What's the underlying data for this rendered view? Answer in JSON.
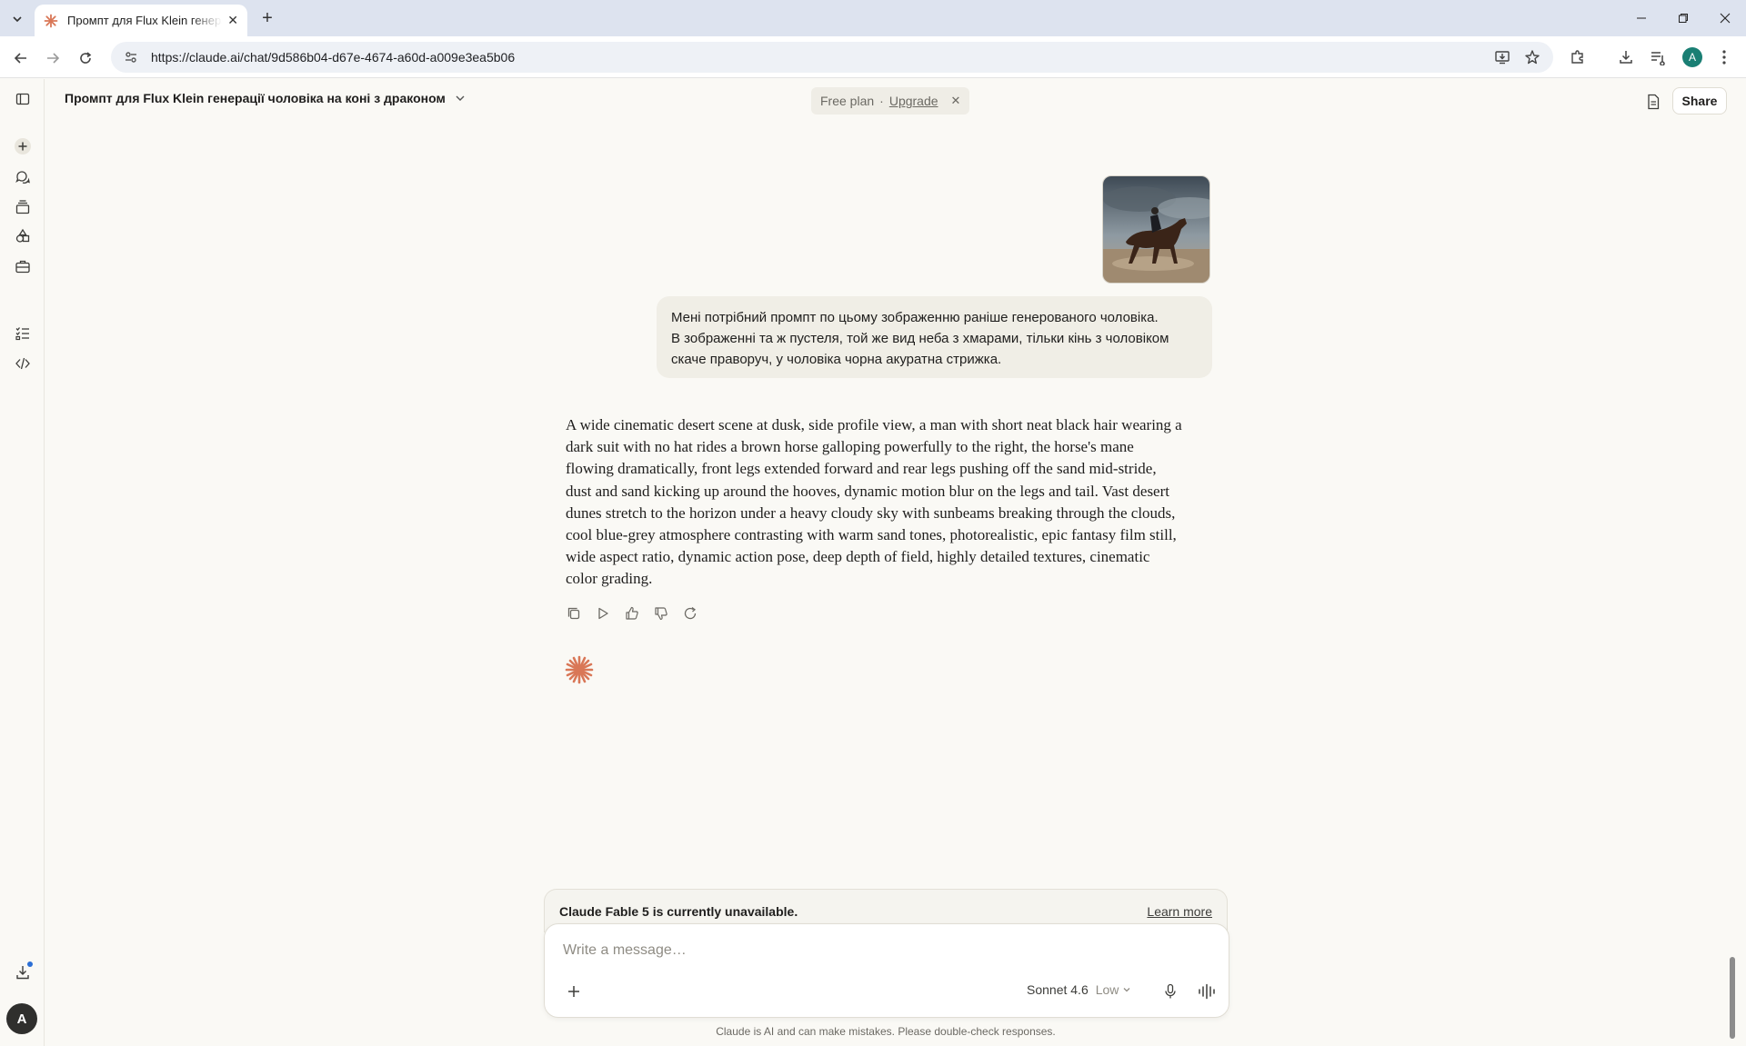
{
  "browser": {
    "tab_title": "Промпт для Flux Klein генерації чоловіка на коні з драконом",
    "url": "https://claude.ai/chat/9d586b04-d67e-4674-a60d-a009e3ea5b06",
    "profile_initial": "A"
  },
  "header": {
    "chat_title": "Промпт для Flux Klein генерації чоловіка на коні з драконом",
    "plan_label": "Free plan",
    "upgrade_label": "Upgrade",
    "share_label": "Share"
  },
  "rail": {
    "avatar_initial": "A"
  },
  "user_message": {
    "text_lines": [
      "Мені потрібний промпт по цьому зображенню раніше генерованого чоловіка.",
      "В зображенні та ж пустеля, той же вид неба з хмарами, тільки кінь з чоловіком",
      "скаче праворуч, у чоловіка чорна акуратна стрижка."
    ]
  },
  "assistant_message": {
    "text": "A wide cinematic desert scene at dusk, side profile view, a man with short neat black hair wearing a dark suit with no hat rides a brown horse galloping powerfully to the right, the horse's mane flowing dramatically, front legs extended forward and rear legs pushing off the sand mid-stride, dust and sand kicking up around the hooves, dynamic motion blur on the legs and tail. Vast desert dunes stretch to the horizon under a heavy cloudy sky with sunbeams breaking through the clouds, cool blue-grey atmosphere contrasting with warm sand tones, photorealistic, epic fantasy film still, wide aspect ratio, dynamic action pose, deep depth of field, highly detailed textures, cinematic color grading."
  },
  "composer": {
    "notice": "Claude Fable 5 is currently unavailable.",
    "learn_more": "Learn more",
    "placeholder": "Write a message…",
    "model": "Sonnet 4.6",
    "effort": "Low",
    "disclaimer": "Claude is AI and can make mistakes. Please double-check responses."
  },
  "colors": {
    "brand_orange": "#d97757",
    "page_bg": "#faf9f5",
    "bubble_bg": "#f0eee6"
  }
}
